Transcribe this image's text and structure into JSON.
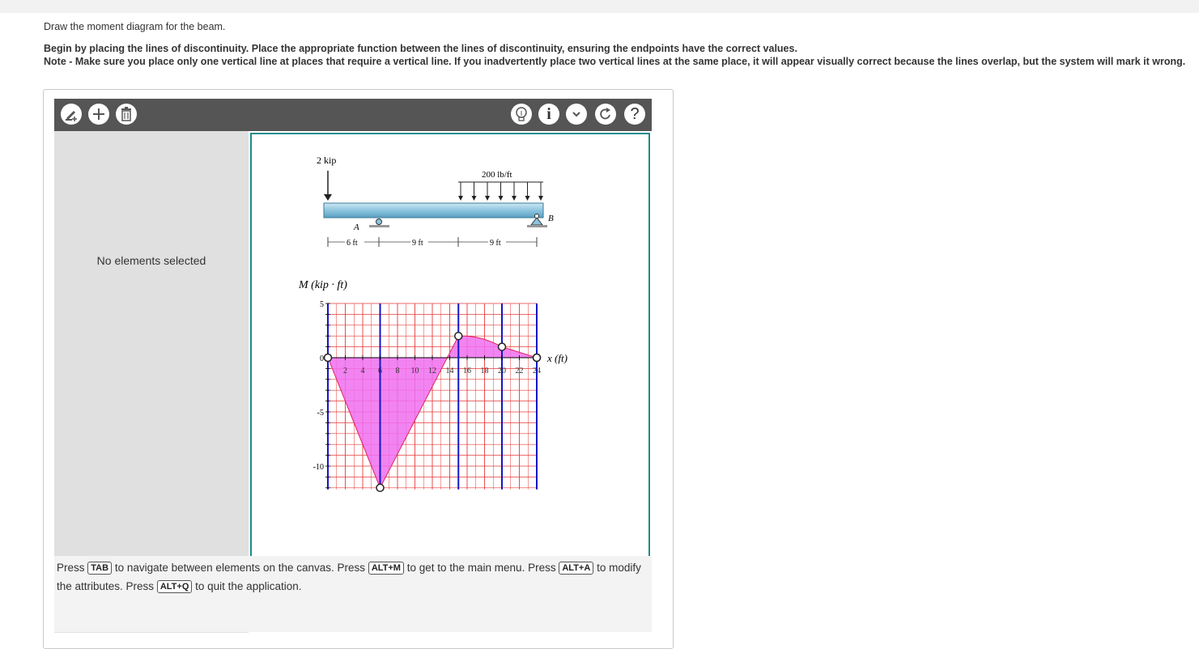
{
  "page": {
    "intro": "Draw the moment diagram for the beam.",
    "instructions": [
      "Begin by placing the lines of discontinuity. Place the appropriate function between the lines of discontinuity, ensuring the endpoints have the correct values.",
      "Note - Make sure you place only one vertical line at places that require a vertical line. If you inadvertently place two vertical lines at the same place, it will appear visually correct because the lines overlap, but the system will mark it wrong."
    ]
  },
  "toolbar": {
    "left_tools": [
      "draw-tool-icon",
      "add-icon",
      "delete-icon"
    ],
    "right_tools": [
      "hint-lightbulb-icon",
      "info-icon",
      "dropdown-chevron-icon",
      "redo-icon",
      "help-icon"
    ],
    "help_glyph": "?",
    "info_glyph": "i"
  },
  "side_panel": {
    "message": "No elements selected"
  },
  "beam_figure": {
    "point_load": "2 kip",
    "distributed_load": "200 lb/ft",
    "support_a": "A",
    "support_b": "B",
    "dimensions": [
      "6 ft",
      "9 ft",
      "9 ft"
    ]
  },
  "graph": {
    "y_label": "M (kip · ft)",
    "x_label": "x (ft)",
    "y_ticks": [
      "5",
      "0",
      "-5",
      "-10"
    ],
    "x_ticks": [
      "2",
      "4",
      "6",
      "8",
      "10",
      "12",
      "14",
      "16",
      "18",
      "20",
      "22",
      "24"
    ],
    "colors": {
      "fill": "#f06ef0",
      "grid": "#e83a3a",
      "discontinuity": "#1515c8",
      "axis": "#000000"
    }
  },
  "chart_data": {
    "type": "area",
    "xlabel": "x (ft)",
    "ylabel": "M (kip · ft)",
    "xlim": [
      0,
      24
    ],
    "ylim": [
      -12,
      5
    ],
    "discontinuity_lines_x": [
      6,
      15,
      20,
      24
    ],
    "points": [
      {
        "x": 0,
        "y": 0
      },
      {
        "x": 6,
        "y": -12
      },
      {
        "x": 15,
        "y": 2
      },
      {
        "x": 20,
        "y": 1
      },
      {
        "x": 24,
        "y": 0
      }
    ]
  },
  "help": {
    "p1": "Press",
    "k1": "TAB",
    "t1": "to navigate between elements on the canvas. Press",
    "k2": "ALT+M",
    "t2": "to get to the main menu. Press",
    "k3": "ALT+A",
    "t3": "to modify the attributes. Press",
    "k4": "ALT+Q",
    "t4": "to quit the application."
  }
}
